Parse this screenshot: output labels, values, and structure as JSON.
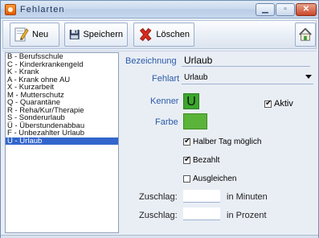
{
  "window": {
    "title": "Fehlarten"
  },
  "toolbar": {
    "neu_label": "Neu",
    "save_label": "Speichern",
    "delete_label": "Löschen"
  },
  "list": {
    "items": [
      "B - Berufsschule",
      "C - Kinderkrankengeld",
      "K - Krank",
      "A - Krank ohne AU",
      "X - Kurzarbeit",
      "M - Mutterschutz",
      "Q - Quarantäne",
      "R - Reha/Kur/Therapie",
      "S - Sonderurlaub",
      "Ü - Überstundenabbau",
      "F - Unbezahlter Urlaub",
      "U - Urlaub"
    ],
    "selected_index": 11
  },
  "form": {
    "bezeichnung_label": "Bezeichnung",
    "bezeichnung_value": "Urlaub",
    "fehlart_label": "Fehlart",
    "fehlart_value": "Urlaub",
    "kenner_label": "Kenner",
    "kenner_value": "U",
    "aktiv_label": "Aktiv",
    "farbe_label": "Farbe",
    "farbe_color": "#5bb43a",
    "halber_tag_label": "Halber Tag möglich",
    "bezahlt_label": "Bezahlt",
    "ausgleichen_label": "Ausgleichen",
    "zuschlag1_label": "Zuschlag:",
    "zuschlag1_unit": "in Minuten",
    "zuschlag2_label": "Zuschlag:",
    "zuschlag2_unit": "in Prozent"
  },
  "checkbox_states": {
    "aktiv": true,
    "halber_tag": true,
    "bezahlt": true,
    "ausgleichen": false
  }
}
